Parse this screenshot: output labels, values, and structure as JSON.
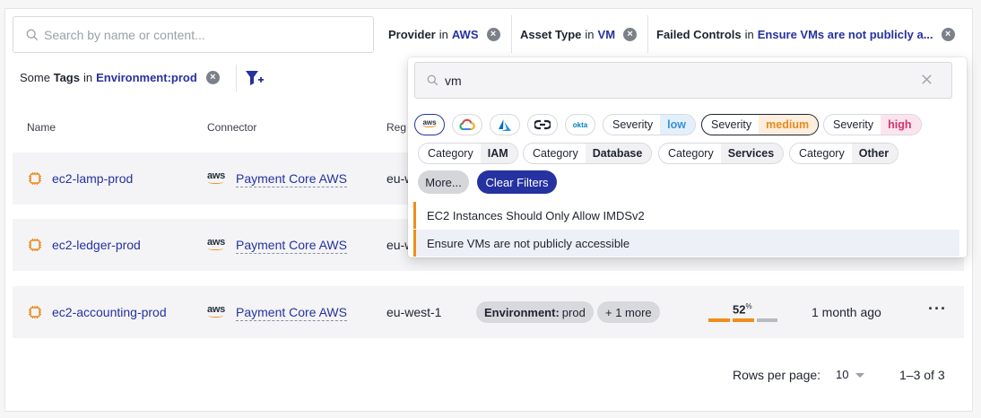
{
  "search": {
    "placeholder": "Search by name or content..."
  },
  "filters": [
    {
      "key": "Provider",
      "in": "in",
      "value": "AWS"
    },
    {
      "key": "Asset Type",
      "in": "in",
      "value": "VM"
    },
    {
      "key": "Failed Controls",
      "in": "in",
      "value": "Ensure VMs are not publicly a..."
    },
    {
      "prefix": "Some",
      "key": "Tags",
      "in": "in",
      "value": "Environment:prod"
    }
  ],
  "table": {
    "headers": {
      "name": "Name",
      "connector": "Connector",
      "region": "Reg"
    },
    "rows": [
      {
        "name": "ec2-lamp-prod",
        "provider": "aws",
        "connector": "Payment Core AWS",
        "region": "eu-w"
      },
      {
        "name": "ec2-ledger-prod",
        "provider": "aws",
        "connector": "Payment Core AWS",
        "region": "eu-w"
      },
      {
        "name": "ec2-accounting-prod",
        "provider": "aws",
        "connector": "Payment Core AWS",
        "region": "eu-west-1",
        "tag_key": "Environment:",
        "tag_value": "prod",
        "more": "+ 1 more",
        "score": "52",
        "score_unit": "%",
        "score_fraction": 0.52,
        "updated": "1 month ago"
      }
    ]
  },
  "pagination": {
    "rows_per_page_label": "Rows per page:",
    "rows_per_page": "10",
    "range": "1–3 of 3"
  },
  "dropdown": {
    "query": "vm",
    "providers": [
      "aws",
      "gcp",
      "azure",
      "link",
      "okta"
    ],
    "severity": [
      {
        "key": "Severity",
        "value": "low",
        "color": "#3b8fd9",
        "bg": "#e3f0fb"
      },
      {
        "key": "Severity",
        "value": "medium",
        "color": "#e98a1d",
        "bg": "#fdeedd"
      },
      {
        "key": "Severity",
        "value": "high",
        "color": "#d6336c",
        "bg": "#fbe4ee"
      }
    ],
    "categories": [
      {
        "key": "Category",
        "value": "IAM"
      },
      {
        "key": "Category",
        "value": "Database"
      },
      {
        "key": "Category",
        "value": "Services"
      },
      {
        "key": "Category",
        "value": "Other"
      }
    ],
    "more_label": "More...",
    "clear_label": "Clear Filters",
    "options": [
      "EC2 Instances Should Only Allow IMDSv2",
      "Ensure VMs are not publicly accessible"
    ],
    "okta_label": "okta",
    "aws_label": "aws"
  },
  "colors": {
    "accent": "#2532a0",
    "orange": "#f08d1b",
    "grey": "#b9bbc0"
  }
}
